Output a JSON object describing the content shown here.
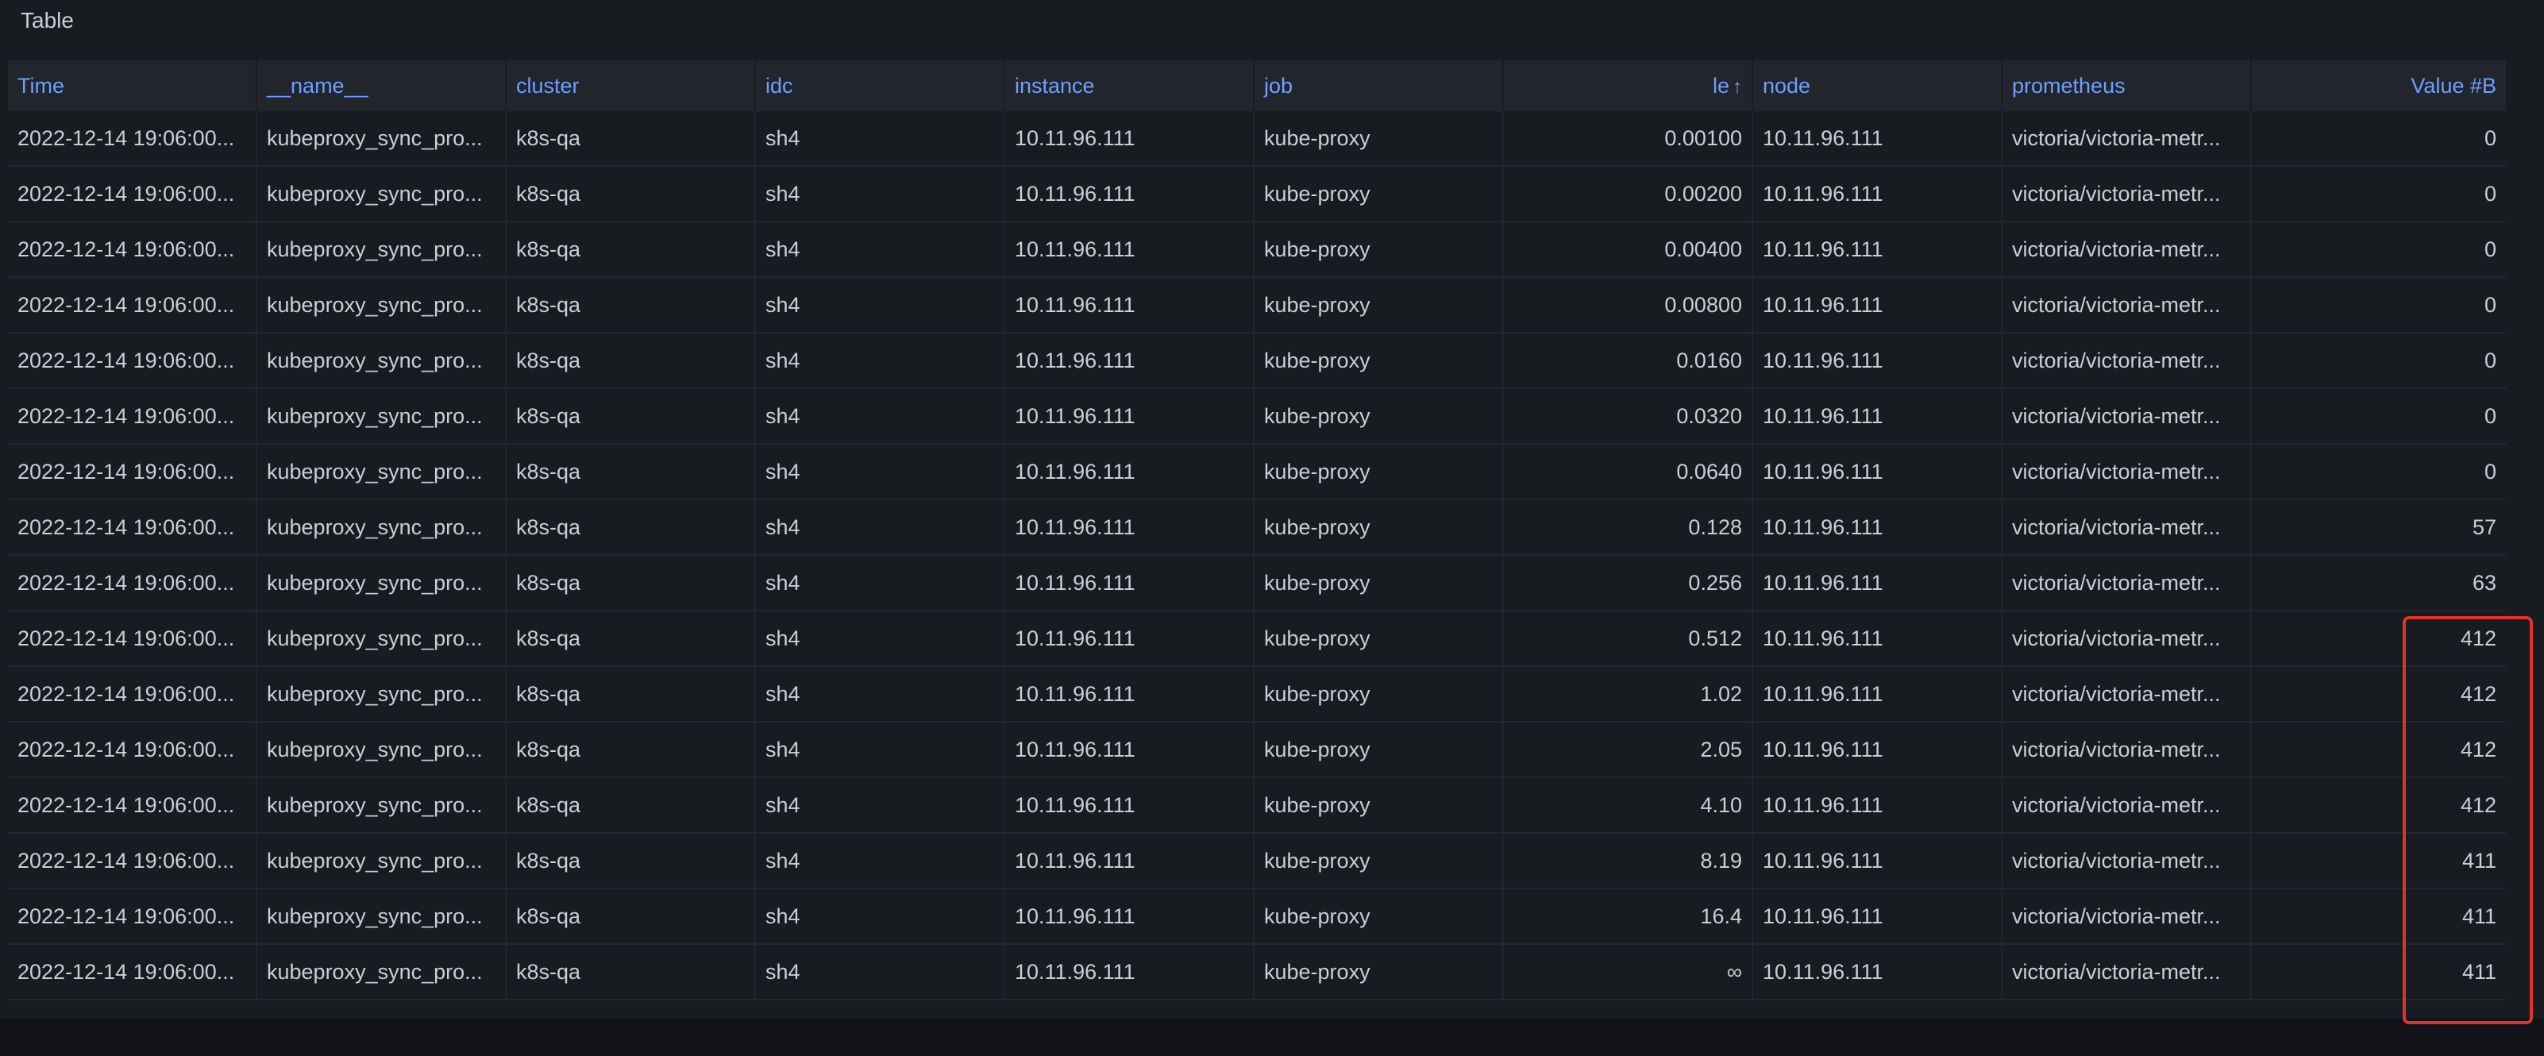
{
  "panel": {
    "title": "Table"
  },
  "table": {
    "columns": [
      {
        "label": "Time",
        "align": "left"
      },
      {
        "label": "__name__",
        "align": "left"
      },
      {
        "label": "cluster",
        "align": "left"
      },
      {
        "label": "idc",
        "align": "left"
      },
      {
        "label": "instance",
        "align": "left"
      },
      {
        "label": "job",
        "align": "left"
      },
      {
        "label": "le",
        "align": "right",
        "sort": "ascending",
        "sort_icon": "↑"
      },
      {
        "label": "node",
        "align": "left"
      },
      {
        "label": "prometheus",
        "align": "left"
      },
      {
        "label": "Value #B",
        "align": "right"
      }
    ],
    "rows": [
      [
        "2022-12-14 19:06:00...",
        "kubeproxy_sync_pro...",
        "k8s-qa",
        "sh4",
        "10.11.96.111",
        "kube-proxy",
        "0.00100",
        "10.11.96.111",
        "victoria/victoria-metr...",
        "0"
      ],
      [
        "2022-12-14 19:06:00...",
        "kubeproxy_sync_pro...",
        "k8s-qa",
        "sh4",
        "10.11.96.111",
        "kube-proxy",
        "0.00200",
        "10.11.96.111",
        "victoria/victoria-metr...",
        "0"
      ],
      [
        "2022-12-14 19:06:00...",
        "kubeproxy_sync_pro...",
        "k8s-qa",
        "sh4",
        "10.11.96.111",
        "kube-proxy",
        "0.00400",
        "10.11.96.111",
        "victoria/victoria-metr...",
        "0"
      ],
      [
        "2022-12-14 19:06:00...",
        "kubeproxy_sync_pro...",
        "k8s-qa",
        "sh4",
        "10.11.96.111",
        "kube-proxy",
        "0.00800",
        "10.11.96.111",
        "victoria/victoria-metr...",
        "0"
      ],
      [
        "2022-12-14 19:06:00...",
        "kubeproxy_sync_pro...",
        "k8s-qa",
        "sh4",
        "10.11.96.111",
        "kube-proxy",
        "0.0160",
        "10.11.96.111",
        "victoria/victoria-metr...",
        "0"
      ],
      [
        "2022-12-14 19:06:00...",
        "kubeproxy_sync_pro...",
        "k8s-qa",
        "sh4",
        "10.11.96.111",
        "kube-proxy",
        "0.0320",
        "10.11.96.111",
        "victoria/victoria-metr...",
        "0"
      ],
      [
        "2022-12-14 19:06:00...",
        "kubeproxy_sync_pro...",
        "k8s-qa",
        "sh4",
        "10.11.96.111",
        "kube-proxy",
        "0.0640",
        "10.11.96.111",
        "victoria/victoria-metr...",
        "0"
      ],
      [
        "2022-12-14 19:06:00...",
        "kubeproxy_sync_pro...",
        "k8s-qa",
        "sh4",
        "10.11.96.111",
        "kube-proxy",
        "0.128",
        "10.11.96.111",
        "victoria/victoria-metr...",
        "57"
      ],
      [
        "2022-12-14 19:06:00...",
        "kubeproxy_sync_pro...",
        "k8s-qa",
        "sh4",
        "10.11.96.111",
        "kube-proxy",
        "0.256",
        "10.11.96.111",
        "victoria/victoria-metr...",
        "63"
      ],
      [
        "2022-12-14 19:06:00...",
        "kubeproxy_sync_pro...",
        "k8s-qa",
        "sh4",
        "10.11.96.111",
        "kube-proxy",
        "0.512",
        "10.11.96.111",
        "victoria/victoria-metr...",
        "412"
      ],
      [
        "2022-12-14 19:06:00...",
        "kubeproxy_sync_pro...",
        "k8s-qa",
        "sh4",
        "10.11.96.111",
        "kube-proxy",
        "1.02",
        "10.11.96.111",
        "victoria/victoria-metr...",
        "412"
      ],
      [
        "2022-12-14 19:06:00...",
        "kubeproxy_sync_pro...",
        "k8s-qa",
        "sh4",
        "10.11.96.111",
        "kube-proxy",
        "2.05",
        "10.11.96.111",
        "victoria/victoria-metr...",
        "412"
      ],
      [
        "2022-12-14 19:06:00...",
        "kubeproxy_sync_pro...",
        "k8s-qa",
        "sh4",
        "10.11.96.111",
        "kube-proxy",
        "4.10",
        "10.11.96.111",
        "victoria/victoria-metr...",
        "412"
      ],
      [
        "2022-12-14 19:06:00...",
        "kubeproxy_sync_pro...",
        "k8s-qa",
        "sh4",
        "10.11.96.111",
        "kube-proxy",
        "8.19",
        "10.11.96.111",
        "victoria/victoria-metr...",
        "411"
      ],
      [
        "2022-12-14 19:06:00...",
        "kubeproxy_sync_pro...",
        "k8s-qa",
        "sh4",
        "10.11.96.111",
        "kube-proxy",
        "16.4",
        "10.11.96.111",
        "victoria/victoria-metr...",
        "411"
      ],
      [
        "2022-12-14 19:06:00...",
        "kubeproxy_sync_pro...",
        "k8s-qa",
        "sh4",
        "10.11.96.111",
        "kube-proxy",
        "∞",
        "10.11.96.111",
        "victoria/victoria-metr...",
        "411"
      ]
    ]
  },
  "annotation": {
    "highlight_color": "#e0332c",
    "highlighted_column": "Value #B",
    "highlighted_rows_from": 10,
    "highlighted_rows_to": 16
  },
  "colors": {
    "background": "#181b1f",
    "header_bg": "#22252b",
    "header_text": "#6e9fff",
    "cell_text": "#ccccdc"
  }
}
